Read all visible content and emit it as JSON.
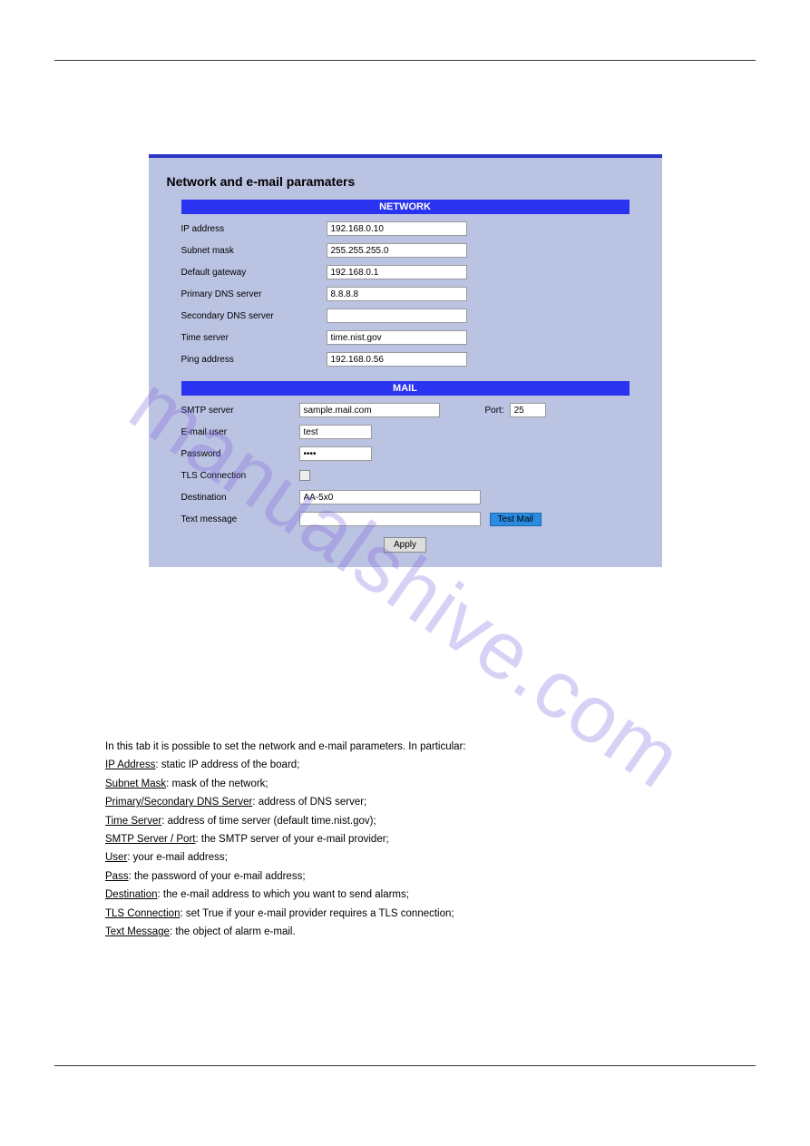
{
  "watermark": "manualshive.com",
  "ui": {
    "title": "Network and e-mail paramaters",
    "section_network": "NETWORK",
    "section_mail": "MAIL",
    "network": {
      "ip_label": "IP address",
      "ip_value": "192.168.0.10",
      "subnet_label": "Subnet mask",
      "subnet_value": "255.255.255.0",
      "gateway_label": "Default gateway",
      "gateway_value": "192.168.0.1",
      "pdns_label": "Primary DNS server",
      "pdns_value": "8.8.8.8",
      "sdns_label": "Secondary DNS server",
      "sdns_value": "",
      "time_label": "Time server",
      "time_value": "time.nist.gov",
      "ping_label": "Ping address",
      "ping_value": "192.168.0.56"
    },
    "mail": {
      "smtp_label": "SMTP server",
      "smtp_value": "sample.mail.com",
      "port_label": "Port:",
      "port_value": "25",
      "user_label": "E-mail user",
      "user_value": "test",
      "pass_label": "Password",
      "pass_value": "••••",
      "tls_label": "TLS Connection",
      "dest_label": "Destination",
      "dest_value": "AA-5x0",
      "text_label": "Text message",
      "text_value": "",
      "testmail_btn": "Test Mail",
      "apply_btn": "Apply"
    }
  },
  "desc": {
    "intro": "In this tab it is possible to set the network and e-mail parameters. In particular:",
    "items": [
      {
        "u": "IP Address",
        "t": ": static IP address of the board;"
      },
      {
        "u": "Subnet Mask",
        "t": ": mask of the network;"
      },
      {
        "u": "Primary/Secondary DNS Server",
        "t": ": address of DNS server;"
      },
      {
        "u": "Time Server",
        "t": ": address of time server (default time.nist.gov);"
      },
      {
        "u": "SMTP Server / Port",
        "t": ": the SMTP server of your e-mail provider;"
      },
      {
        "u": "User",
        "t": ": your e-mail address;"
      },
      {
        "u": "Pass",
        "t": ": the password of your e-mail address;"
      },
      {
        "u": "Destination",
        "t": ": the e-mail address to which you want to send alarms;"
      },
      {
        "u": "TLS Connection",
        "t": ": set True if your e-mail provider requires a TLS connection;"
      },
      {
        "u": "Text Message",
        "t": ": the object of alarm e-mail."
      }
    ]
  }
}
